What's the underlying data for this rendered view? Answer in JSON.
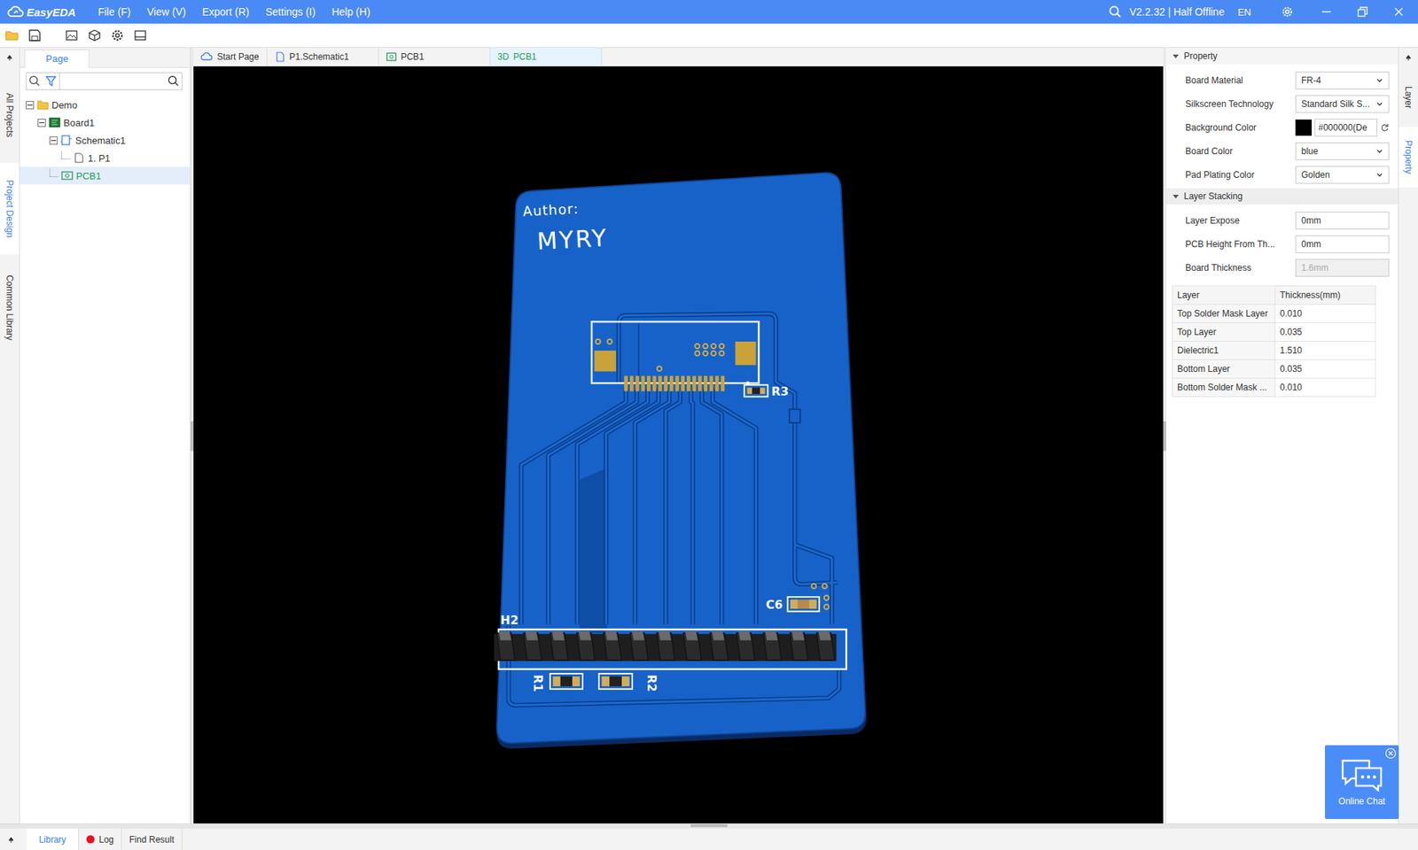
{
  "app": {
    "logo": "EasyEDA",
    "version": "V2.2.32 | Half Offline",
    "language": "EN"
  },
  "menu": [
    "File (F)",
    "View (V)",
    "Export (R)",
    "Settings (I)",
    "Help (H)"
  ],
  "left_rail": [
    {
      "label": "All Projects",
      "selected": false
    },
    {
      "label": "Project Design",
      "selected": true
    },
    {
      "label": "Common Library",
      "selected": false
    }
  ],
  "left_panel": {
    "tabs": [
      {
        "label": "Page",
        "selected": true
      }
    ],
    "tree": [
      {
        "label": "Demo",
        "kind": "folder",
        "expanded": true,
        "selected": false,
        "children": [
          {
            "label": "Board1",
            "kind": "board",
            "expanded": true,
            "selected": false,
            "children": [
              {
                "label": "Schematic1",
                "kind": "schematic",
                "expanded": true,
                "selected": false,
                "children": [
                  {
                    "label": "1. P1",
                    "kind": "page",
                    "selected": false,
                    "children": []
                  }
                ]
              },
              {
                "label": "PCB1",
                "kind": "pcb",
                "selected": true,
                "children": []
              }
            ]
          }
        ]
      }
    ]
  },
  "doc_tabs": [
    {
      "label": "Start Page",
      "kind": "start",
      "prefix": "",
      "selected": false
    },
    {
      "label": "P1.Schematic1",
      "kind": "schematic",
      "prefix": "",
      "selected": false
    },
    {
      "label": "PCB1",
      "kind": "pcb",
      "prefix": "",
      "selected": false
    },
    {
      "label": "PCB1",
      "kind": "3d",
      "prefix": "3D",
      "selected": true
    }
  ],
  "pcb": {
    "author_label": "Author:",
    "author": "MYRY",
    "components": [
      {
        "ref": "R3",
        "kind": "resistor"
      },
      {
        "ref": "C6",
        "kind": "capacitor"
      },
      {
        "ref": "H2",
        "kind": "header"
      },
      {
        "ref": "R1",
        "kind": "resistor"
      },
      {
        "ref": "R2",
        "kind": "resistor"
      }
    ]
  },
  "property": {
    "title": "Property",
    "expanded": true,
    "rows": [
      {
        "label": "Board Material",
        "value": "FR-4",
        "kind": "select"
      },
      {
        "label": "Silkscreen Technology",
        "value": "Standard Silk S...",
        "kind": "select"
      },
      {
        "label": "Background Color",
        "value": "#000000(De",
        "kind": "color",
        "swatch": "#000000"
      },
      {
        "label": "Board Color",
        "value": "blue",
        "kind": "select"
      },
      {
        "label": "Pad Plating Color",
        "value": "Golden",
        "kind": "select"
      }
    ]
  },
  "layer_stacking": {
    "title": "Layer Stacking",
    "expanded": true,
    "rows": [
      {
        "label": "Layer Expose",
        "value": "0mm",
        "disabled": false
      },
      {
        "label": "PCB Height From Th...",
        "value": "0mm",
        "disabled": false
      },
      {
        "label": "Board Thickness",
        "value": "1.6mm",
        "disabled": true
      }
    ],
    "table": {
      "columns": [
        "Layer",
        "Thickness(mm)"
      ],
      "rows": [
        [
          "Top Solder Mask Layer",
          "0.010"
        ],
        [
          "Top Layer",
          "0.035"
        ],
        [
          "Dielectric1",
          "1.510"
        ],
        [
          "Bottom Layer",
          "0.035"
        ],
        [
          "Bottom Solder Mask ...",
          "0.010"
        ]
      ]
    }
  },
  "right_rail": [
    {
      "label": "Layer",
      "selected": false
    },
    {
      "label": "Property",
      "selected": true
    }
  ],
  "chat": {
    "label": "Online Chat"
  },
  "bottom_tabs": [
    {
      "label": "Library",
      "selected": true
    },
    {
      "label": "Log",
      "selected": false,
      "color": "#e81123"
    },
    {
      "label": "Find Result",
      "selected": false
    }
  ]
}
